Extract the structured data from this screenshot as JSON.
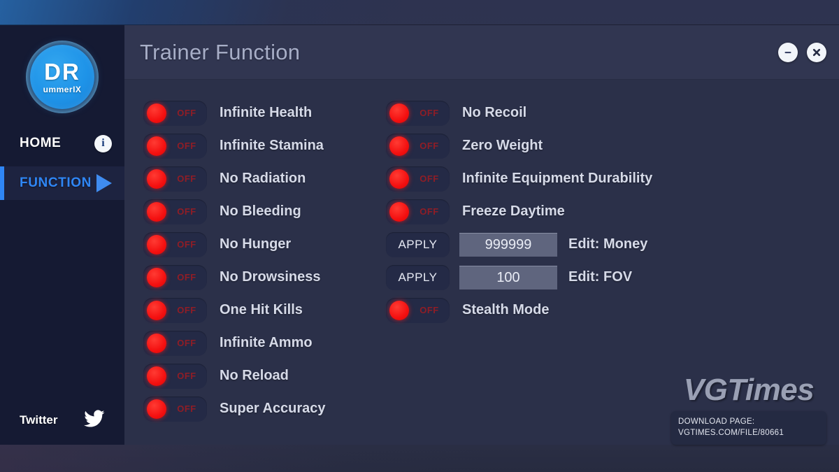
{
  "window": {
    "title": "Trainer Function",
    "minimize_label": "minimize",
    "close_label": "close"
  },
  "sidebar": {
    "logo": {
      "primary": "DR",
      "secondary": "ummerIX"
    },
    "nav": [
      {
        "label": "HOME",
        "icon": "info-icon",
        "active": false
      },
      {
        "label": "FUNCTION",
        "icon": "play-triangle-icon",
        "active": true
      }
    ],
    "footer": {
      "label": "Twitter",
      "icon": "twitter-bird-icon"
    }
  },
  "functions": {
    "left_column": [
      {
        "label": "Infinite Health",
        "state": "OFF"
      },
      {
        "label": "Infinite Stamina",
        "state": "OFF"
      },
      {
        "label": "No Radiation",
        "state": "OFF"
      },
      {
        "label": "No Bleeding",
        "state": "OFF"
      },
      {
        "label": "No Hunger",
        "state": "OFF"
      },
      {
        "label": "No Drowsiness",
        "state": "OFF"
      },
      {
        "label": "One Hit Kills",
        "state": "OFF"
      },
      {
        "label": "Infinite Ammo",
        "state": "OFF"
      },
      {
        "label": "No Reload",
        "state": "OFF"
      },
      {
        "label": "Super Accuracy",
        "state": "OFF"
      }
    ],
    "right_column": [
      {
        "type": "toggle",
        "label": "No Recoil",
        "state": "OFF"
      },
      {
        "type": "toggle",
        "label": "Zero Weight",
        "state": "OFF"
      },
      {
        "type": "toggle",
        "label": "Infinite Equipment Durability",
        "state": "OFF"
      },
      {
        "type": "toggle",
        "label": "Freeze Daytime",
        "state": "OFF"
      },
      {
        "type": "edit",
        "label": "Edit: Money",
        "button": "APPLY",
        "value": "999999"
      },
      {
        "type": "edit",
        "label": "Edit: FOV",
        "button": "APPLY",
        "value": "100"
      },
      {
        "type": "toggle",
        "label": "Stealth Mode",
        "state": "OFF"
      }
    ]
  },
  "watermark": {
    "title": "VGTimes",
    "line1": "DOWNLOAD PAGE:",
    "line2": "VGTIMES.COM/FILE/80661"
  },
  "colors": {
    "accent_blue": "#2f86f5",
    "toggle_red": "#f41010",
    "panel_bg": "#2b3049",
    "sidebar_bg": "#151a33",
    "titlebar_bg": "#313651"
  }
}
